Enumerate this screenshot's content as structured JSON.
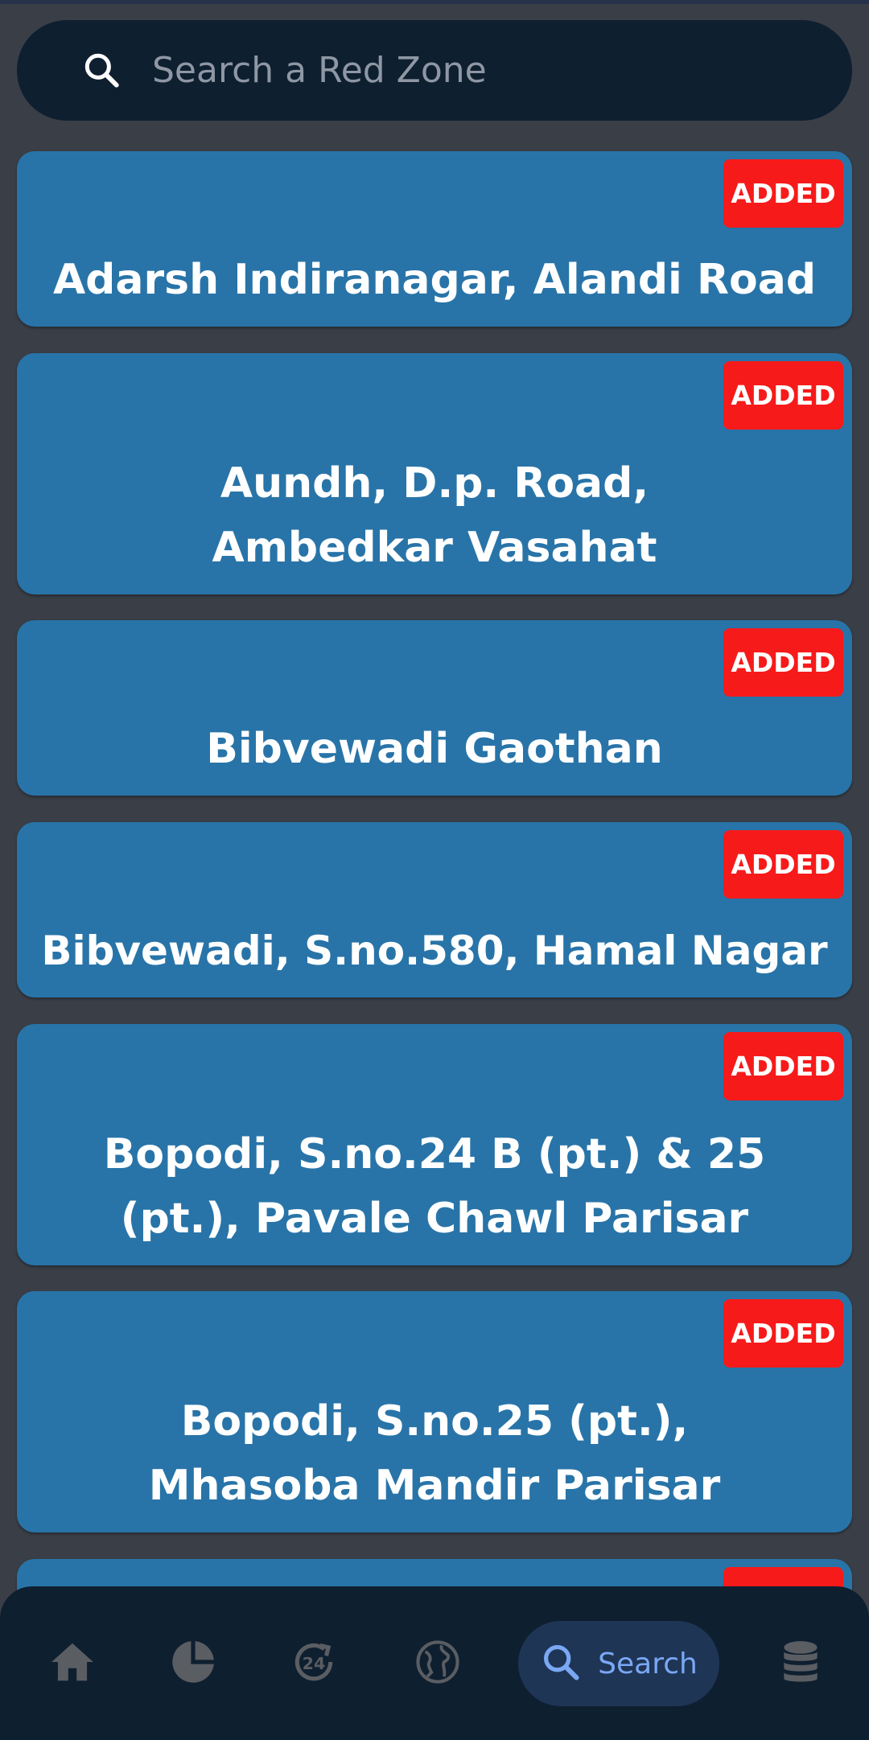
{
  "search": {
    "placeholder": "Search a Red Zone"
  },
  "zones": [
    {
      "name": "Adarsh Indiranagar, Alandi Road",
      "badge": "ADDED"
    },
    {
      "name": "Aundh, D.p. Road, Ambedkar Vasahat",
      "badge": "ADDED"
    },
    {
      "name": "Bibvewadi Gaothan",
      "badge": "ADDED"
    },
    {
      "name": "Bibvewadi, S.no.580, Hamal Nagar",
      "badge": "ADDED"
    },
    {
      "name": "Bopodi, S.no.24 B (pt.) & 25 (pt.), Pavale Chawl Parisar",
      "badge": "ADDED"
    },
    {
      "name": "Bopodi, S.no.25 (pt.), Mhasoba Mandir Parisar",
      "badge": "ADDED"
    }
  ],
  "nav": {
    "items": [
      {
        "icon": "home-icon"
      },
      {
        "icon": "pie-chart-icon"
      },
      {
        "icon": "24-hours-icon",
        "text": "24"
      },
      {
        "icon": "globe-icon"
      },
      {
        "icon": "search-icon",
        "label": "Search",
        "active": true
      },
      {
        "icon": "database-icon"
      }
    ]
  },
  "colors": {
    "background": "#3a3e47",
    "card": "#2874a8",
    "badge": "#f71a1a",
    "navbar": "#0e1f30",
    "active_pill": "#1f3556",
    "active_text": "#7aa8f5",
    "inactive_icon": "#5a5d62"
  }
}
